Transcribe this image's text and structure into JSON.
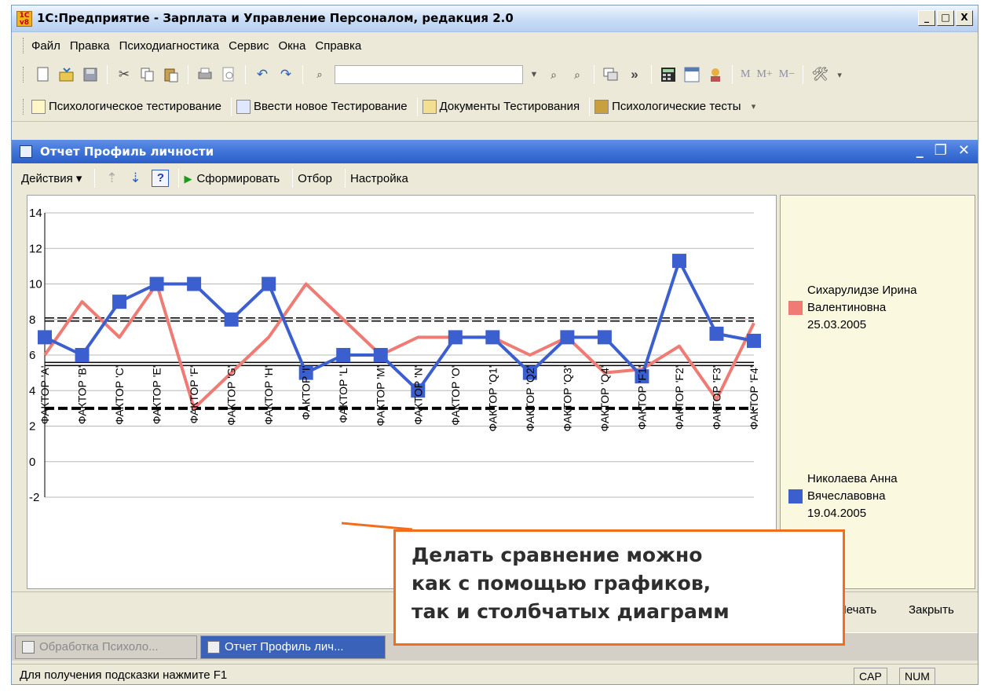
{
  "window": {
    "title": "1С:Предприятие - Зарплата и Управление Персоналом, редакция 2.0",
    "app_icon_text": "1C v8",
    "minimize": "_",
    "maximize": "□",
    "close": "X"
  },
  "menu": [
    "Файл",
    "Правка",
    "Психодиагностика",
    "Сервис",
    "Окна",
    "Справка"
  ],
  "toolbar": {
    "memory_buttons": [
      "M",
      "M+",
      "M−"
    ],
    "overflow": "»"
  },
  "quick_panel": [
    "Психологическое тестирование",
    "Ввести новое Тестирование",
    "Документы Тестирования",
    "Психологические тесты"
  ],
  "document": {
    "title": "Отчет  Профиль личности",
    "actions_label": "Действия",
    "help_label": "?",
    "generate_label": "Сформировать",
    "filter_label": "Отбор",
    "settings_label": "Настройка",
    "print_label": "Печать",
    "close_label": "Закрыть"
  },
  "chart_data": {
    "type": "line",
    "categories": [
      "ФАКТОР 'A'",
      "ФАКТОР 'B'",
      "ФАКТОР 'C'",
      "ФАКТОР 'E'",
      "ФАКТОР 'F'",
      "ФАКТОР 'G'",
      "ФАКТОР 'H'",
      "ФАКТОР 'I'",
      "ФАКТОР 'L'",
      "ФАКТОР 'M'",
      "ФАКТОР 'N'",
      "ФАКТОР 'O'",
      "ФАКТОР 'Q1'",
      "ФАКТОР 'Q2'",
      "ФАКТОР 'Q3'",
      "ФАКТОР 'Q4'",
      "ФАКТОР 'F1'",
      "ФАКТОР 'F2'",
      "ФАКТОР 'F3'",
      "ФАКТОР 'F4'"
    ],
    "series": [
      {
        "name": "Сихарулидзе Ирина Валентиновна 25.03.2005",
        "color": "#ef7b74",
        "values": [
          6,
          9,
          7,
          10,
          3,
          5,
          7,
          10,
          8,
          6,
          7,
          7,
          7,
          6,
          7,
          5,
          5.2,
          6.5,
          3.5,
          7.8
        ]
      },
      {
        "name": "Николаева Анна Вячеславовна 19.04.2005",
        "color": "#3c5fd0",
        "values": [
          7,
          6,
          9,
          10,
          10,
          8,
          10,
          5,
          6,
          6,
          4,
          7,
          7,
          5,
          7,
          7,
          4.8,
          11.3,
          7.2,
          6.8
        ]
      }
    ],
    "reference_lines": [
      {
        "value": 8,
        "style": "double-dashed"
      },
      {
        "value": 5.5,
        "style": "double-solid"
      },
      {
        "value": 3,
        "style": "bold-dashed"
      }
    ],
    "yticks": [
      14,
      12,
      10,
      8,
      6,
      4,
      2,
      0,
      -2
    ],
    "ylim": [
      -2,
      14
    ],
    "grid": true,
    "legend_position": "right"
  },
  "taskbar": [
    "Обработка  Психоло...",
    "Отчет  Профиль лич..."
  ],
  "status": {
    "hint": "Для получения подсказки нажмите F1",
    "cap": "CAP",
    "num": "NUM"
  },
  "callout": {
    "line1": "Делать сравнение можно",
    "line2": "как с помощью графиков,",
    "line3": "так и столбчатых диаграмм"
  }
}
